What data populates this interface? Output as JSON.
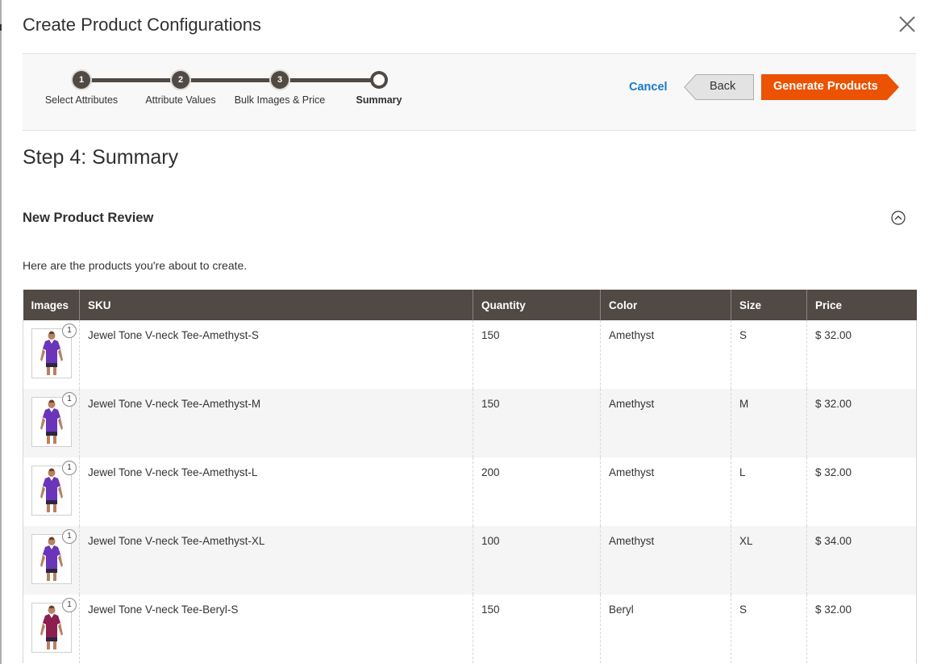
{
  "modal": {
    "title": "Create Product Configurations"
  },
  "wizard": {
    "steps": [
      {
        "number": "1",
        "label": "Select Attributes"
      },
      {
        "number": "2",
        "label": "Attribute Values"
      },
      {
        "number": "3",
        "label": "Bulk Images & Price"
      },
      {
        "number": "",
        "label": "Summary"
      }
    ],
    "cancel_label": "Cancel",
    "back_label": "Back",
    "generate_label": "Generate Products"
  },
  "content": {
    "step_heading": "Step 4: Summary",
    "section_title": "New Product Review",
    "intro": "Here are the products you're about to create."
  },
  "table": {
    "columns": [
      "Images",
      "SKU",
      "Quantity",
      "Color",
      "Size",
      "Price"
    ],
    "rows": [
      {
        "image_count": "1",
        "sku": "Jewel Tone V-neck Tee-Amethyst-S",
        "quantity": "150",
        "color": "Amethyst",
        "size": "S",
        "price": "$ 32.00"
      },
      {
        "image_count": "1",
        "sku": "Jewel Tone V-neck Tee-Amethyst-M",
        "quantity": "150",
        "color": "Amethyst",
        "size": "M",
        "price": "$ 32.00"
      },
      {
        "image_count": "1",
        "sku": "Jewel Tone V-neck Tee-Amethyst-L",
        "quantity": "200",
        "color": "Amethyst",
        "size": "L",
        "price": "$ 32.00"
      },
      {
        "image_count": "1",
        "sku": "Jewel Tone V-neck Tee-Amethyst-XL",
        "quantity": "100",
        "color": "Amethyst",
        "size": "XL",
        "price": "$ 34.00"
      },
      {
        "image_count": "1",
        "sku": "Jewel Tone V-neck Tee-Beryl-S",
        "quantity": "150",
        "color": "Beryl",
        "size": "S",
        "price": "$ 32.00"
      }
    ]
  },
  "colors": {
    "accent": "#eb5202",
    "header_bg": "#514943",
    "link": "#1979c3"
  }
}
